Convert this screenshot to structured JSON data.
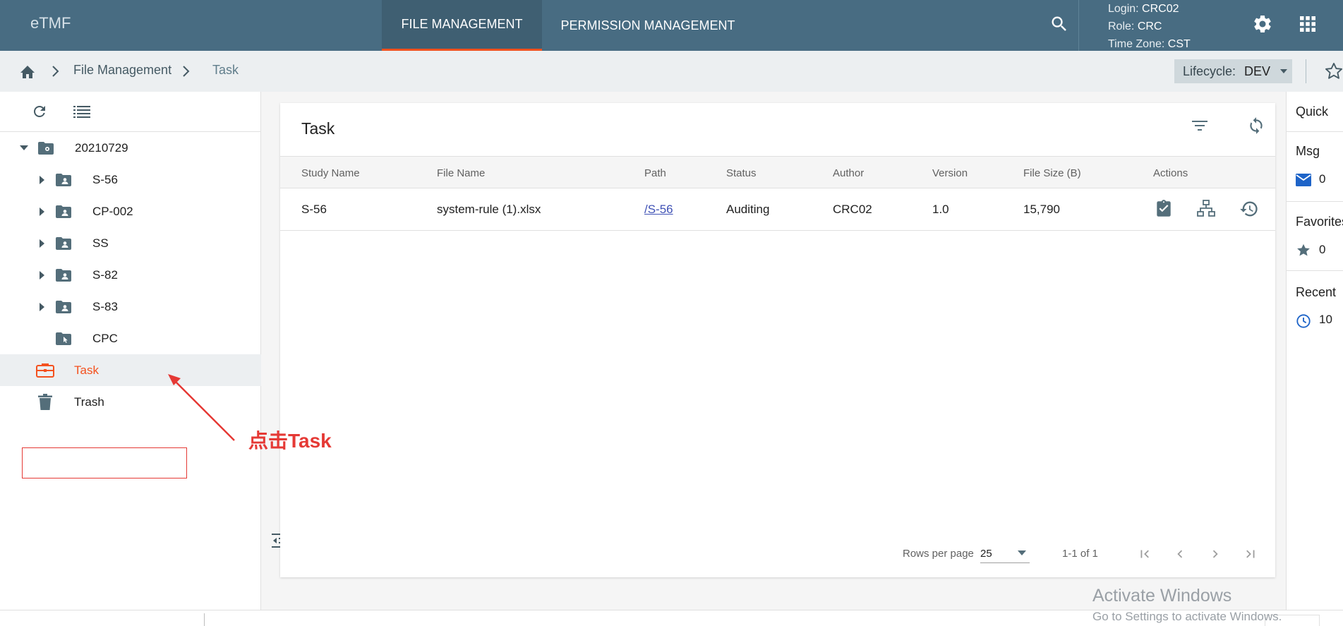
{
  "app": {
    "logo": "eTMF"
  },
  "nav": {
    "tabs": [
      {
        "label": "FILE MANAGEMENT",
        "active": true
      },
      {
        "label": "PERMISSION MANAGEMENT",
        "active": false
      }
    ]
  },
  "user": {
    "login_label": "Login:",
    "login": "CRC02",
    "role_label": "Role:",
    "role": "CRC",
    "tz_label": "Time Zone:",
    "tz": "CST"
  },
  "breadcrumb": {
    "items": [
      "File Management",
      "Task"
    ]
  },
  "lifecycle": {
    "label": "Lifecycle:",
    "value": "DEV"
  },
  "tree": {
    "root": "20210729",
    "children": [
      "S-56",
      "CP-002",
      "SS",
      "S-82",
      "S-83",
      "CPC"
    ],
    "task": "Task",
    "trash": "Trash"
  },
  "card": {
    "title": "Task"
  },
  "table": {
    "headers": [
      "Study Name",
      "File Name",
      "Path",
      "Status",
      "Author",
      "Version",
      "File Size (B)",
      "Actions"
    ],
    "rows": [
      {
        "study": "S-56",
        "file": "system-rule (1).xlsx",
        "path": "/S-56",
        "status": "Auditing",
        "author": "CRC02",
        "version": "1.0",
        "size": "15,790"
      }
    ]
  },
  "pager": {
    "rows_label": "Rows per page",
    "rows_value": "25",
    "range": "1-1 of 1"
  },
  "quick": {
    "title": "Quick",
    "msg_label": "Msg",
    "msg_count": "0",
    "fav_label": "Favorites",
    "fav_count": "0",
    "recent_label": "Recent",
    "recent_count": "10"
  },
  "watermark": {
    "line1": "Activate Windows",
    "line2": "Go to Settings to activate Windows."
  },
  "annotation": {
    "text": "点击Task"
  },
  "colors": {
    "topbar": "#486c82",
    "accent": "#f4511e",
    "annotation": "#e53935"
  }
}
